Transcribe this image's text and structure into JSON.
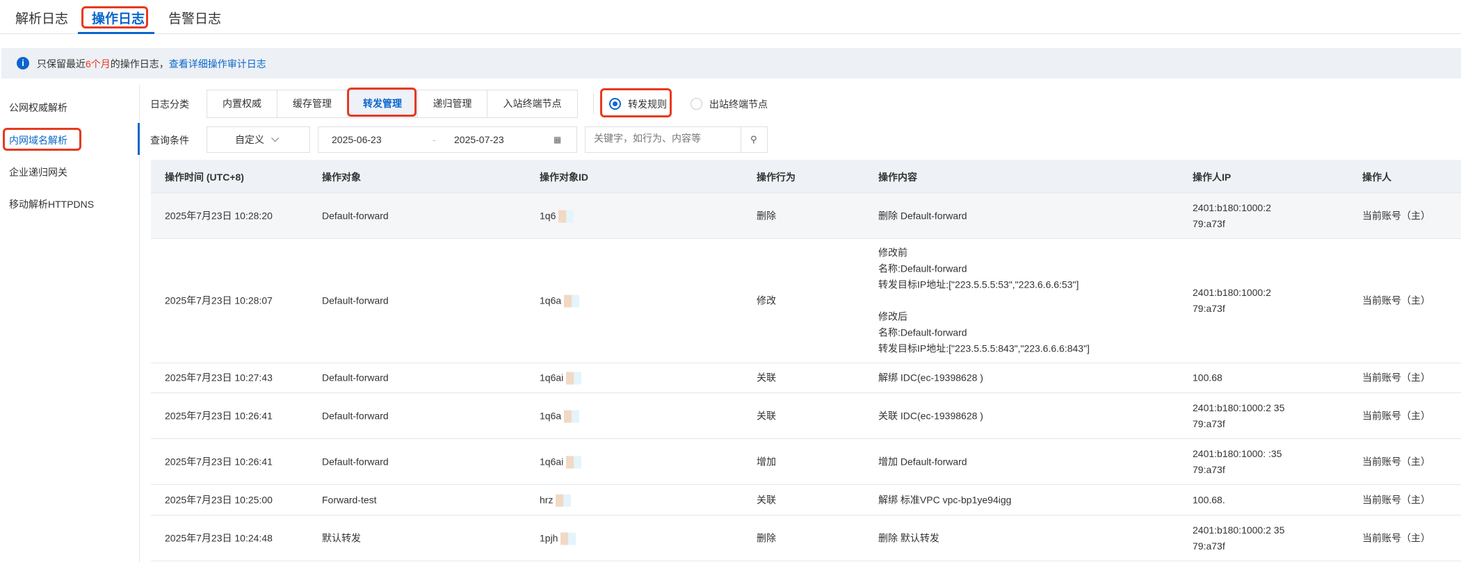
{
  "tabs": [
    {
      "label": "解析日志"
    },
    {
      "label": "操作日志",
      "active": true
    },
    {
      "label": "告警日志"
    }
  ],
  "notice": {
    "prefix": "只保留最近",
    "highlight": "6个月",
    "suffix": "的操作日志，",
    "link": "查看详细操作审计日志"
  },
  "sidebar": {
    "items": [
      {
        "label": "公网权威解析"
      },
      {
        "label": "内网域名解析",
        "active": true
      },
      {
        "label": "企业递归网关"
      },
      {
        "label": "移动解析HTTPDNS"
      }
    ]
  },
  "filters": {
    "category_label": "日志分类",
    "categories": [
      {
        "label": "内置权威"
      },
      {
        "label": "缓存管理"
      },
      {
        "label": "转发管理",
        "active": true
      },
      {
        "label": "递归管理"
      },
      {
        "label": "入站终端节点"
      }
    ],
    "sub_types": [
      {
        "label": "转发规则",
        "checked": true
      },
      {
        "label": "出站终端节点",
        "checked": false
      }
    ],
    "query_label": "查询条件",
    "range_select": "自定义",
    "date_start": "2025-06-23",
    "date_sep": "-",
    "date_end": "2025-07-23",
    "search_placeholder": "关键字，如行为、内容等"
  },
  "table": {
    "columns": [
      "操作时间 (UTC+8)",
      "操作对象",
      "操作对象ID",
      "操作行为",
      "操作内容",
      "操作人IP",
      "操作人"
    ],
    "rows": [
      {
        "time": "2025年7月23日 10:28:20",
        "object": "Default-forward",
        "id": "1q6",
        "action": "删除",
        "content": [
          "删除 Default-forward"
        ],
        "ip": [
          "2401:b180:1000:2",
          "79:a73f"
        ],
        "operator": "当前账号（主）"
      },
      {
        "time": "2025年7月23日 10:28:07",
        "object": "Default-forward",
        "id": "1q6a",
        "action": "修改",
        "content": [
          "修改前",
          "名称:Default-forward",
          "转发目标IP地址:[\"223.5.5.5:53\",\"223.6.6.6:53\"]",
          "",
          "修改后",
          "名称:Default-forward",
          "转发目标IP地址:[\"223.5.5.5:843\",\"223.6.6.6:843\"]"
        ],
        "ip": [
          "2401:b180:1000:2",
          "79:a73f"
        ],
        "operator": "当前账号（主）"
      },
      {
        "time": "2025年7月23日 10:27:43",
        "object": "Default-forward",
        "id": "1q6ai",
        "action": "关联",
        "content": [
          "解绑 IDC(ec-19398628 )"
        ],
        "ip": [
          "100.68"
        ],
        "operator": "当前账号（主）"
      },
      {
        "time": "2025年7月23日 10:26:41",
        "object": "Default-forward",
        "id": "1q6a",
        "action": "关联",
        "content": [
          "关联 IDC(ec-19398628 )"
        ],
        "ip": [
          "2401:b180:1000:2 35",
          "79:a73f"
        ],
        "operator": "当前账号（主）"
      },
      {
        "time": "2025年7月23日 10:26:41",
        "object": "Default-forward",
        "id": "1q6ai",
        "action": "增加",
        "content": [
          "增加 Default-forward"
        ],
        "ip": [
          "2401:b180:1000: :35",
          "79:a73f"
        ],
        "operator": "当前账号（主）"
      },
      {
        "time": "2025年7月23日 10:25:00",
        "object": "Forward-test",
        "id": "hrz",
        "action": "关联",
        "content": [
          "解绑 标准VPC vpc-bp1ye94igg"
        ],
        "ip": [
          "100.68."
        ],
        "operator": "当前账号（主）"
      },
      {
        "time": "2025年7月23日 10:24:48",
        "object": "默认转发",
        "id": "1pjh",
        "action": "删除",
        "content": [
          "删除 默认转发"
        ],
        "ip": [
          "2401:b180:1000:2 35",
          "79:a73f"
        ],
        "operator": "当前账号（主）"
      }
    ]
  }
}
